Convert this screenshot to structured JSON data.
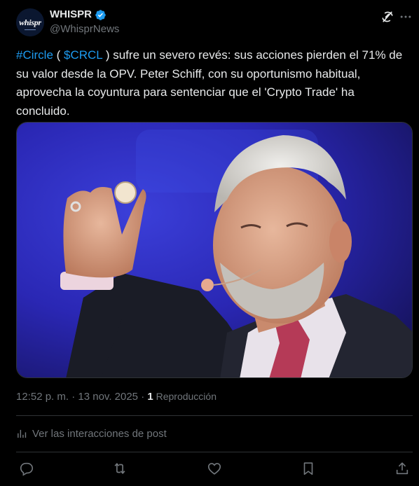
{
  "author": {
    "name": "WHISPR",
    "handle": "@WhisprNews",
    "avatar_text": "whispr",
    "verified_icon": "verified-badge-icon"
  },
  "post": {
    "hashtag": "#Circle",
    "paren_open": " ( ",
    "cashtag": "$CRCL",
    "text_rest": " ) sufre un severo revés: sus acciones pierden el 71% de su valor desde la OPV. Peter Schiff, con su oportunismo habitual, aprovecha la coyuntura para sentenciar que el 'Crypto Trade' ha concluido."
  },
  "meta": {
    "time": "12:52 p. m.",
    "separator": " · ",
    "date": "13 nov. 2025",
    "separator2": " · ",
    "views_count": "1",
    "views_label": " Reproducción"
  },
  "interactions": {
    "label": "Ver las interacciones de post"
  },
  "actions": [
    "reply-icon",
    "repost-icon",
    "like-icon",
    "bookmark-icon",
    "share-icon"
  ],
  "colors": {
    "background": "#000000",
    "text": "#e7e9ea",
    "secondary": "#71767b",
    "link": "#1d9bf0",
    "divider": "#2f3336"
  }
}
